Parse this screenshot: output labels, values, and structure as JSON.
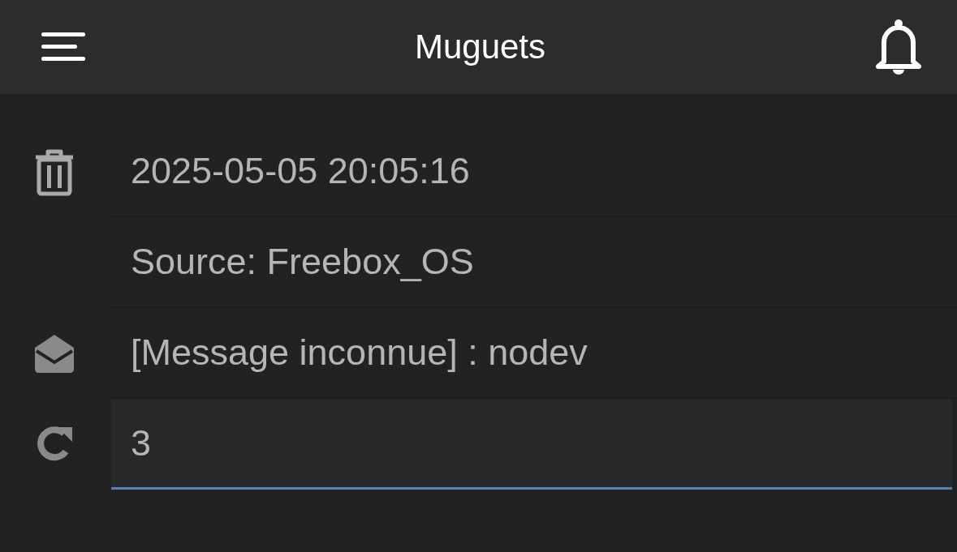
{
  "header": {
    "title": "Muguets"
  },
  "date_row": {
    "text": "2025-05-05 20:05:16"
  },
  "source_row": {
    "text": "Source: Freebox_OS"
  },
  "message_row": {
    "text": "[Message inconnue] : nodev"
  },
  "count_field": {
    "value": "3",
    "focused": true
  }
}
